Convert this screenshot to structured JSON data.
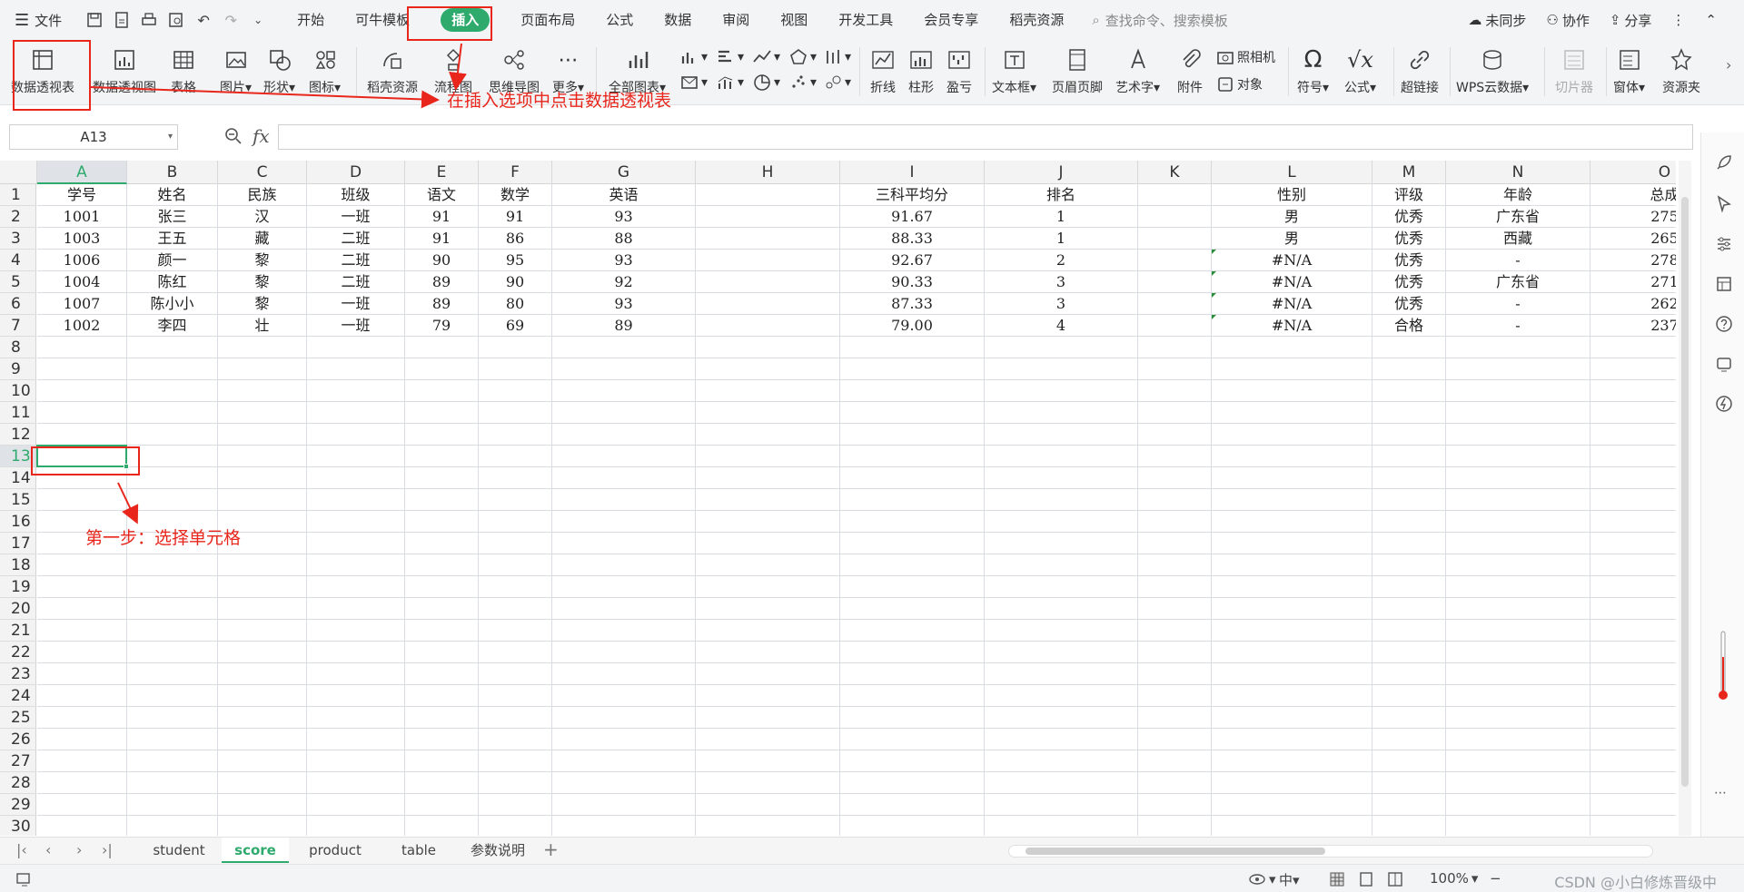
{
  "menubar": {
    "file_label": "文件",
    "tabs": [
      "开始",
      "可牛模板",
      "插入",
      "页面布局",
      "公式",
      "数据",
      "审阅",
      "视图",
      "开发工具",
      "会员专享",
      "稻壳资源"
    ],
    "active_tab": "插入",
    "search_placeholder": "查找命令、搜索模板",
    "right": {
      "sync": "未同步",
      "collab": "协作",
      "share": "分享"
    }
  },
  "ribbon": {
    "big_buttons": {
      "pivot_table": "数据透视表",
      "pivot_chart": "数据透视图",
      "table": "表格",
      "picture": "图片",
      "shape": "形状",
      "icon": "图标",
      "docer": "稻壳资源",
      "flowchart": "流程图",
      "mindmap": "思维导图",
      "more": "更多",
      "all_charts": "全部图表",
      "line": "折线",
      "column": "柱形",
      "winloss": "盈亏",
      "textbox": "文本框",
      "header_footer": "页眉页脚",
      "wordart": "艺术字",
      "attachment": "附件",
      "camera": "照相机",
      "object": "对象",
      "symbol": "符号",
      "formula": "公式",
      "hyperlink": "超链接",
      "wps_cloud": "WPS云数据",
      "slicer": "切片器",
      "window": "窗体",
      "resources": "资源夹"
    }
  },
  "formula_bar": {
    "name_box": "A13",
    "fx": "fx",
    "value": ""
  },
  "columns": [
    "A",
    "B",
    "C",
    "D",
    "E",
    "F",
    "G",
    "H",
    "I",
    "J",
    "K",
    "L",
    "M",
    "N",
    "O"
  ],
  "selected_column": "A",
  "selected_row": "13",
  "rows": [
    "1",
    "2",
    "3",
    "4",
    "5",
    "6",
    "7",
    "8",
    "9",
    "10",
    "11",
    "12",
    "13",
    "14",
    "15",
    "16",
    "17",
    "18",
    "19",
    "20",
    "21",
    "22",
    "23",
    "24",
    "25",
    "26",
    "27",
    "28",
    "29",
    "30"
  ],
  "table": {
    "header": {
      "A": "学号",
      "B": "姓名",
      "C": "民族",
      "D": "班级",
      "E": "语文",
      "F": "数学",
      "G": "英语",
      "I": "三科平均分",
      "J": "排名",
      "L": "性别",
      "M": "评级",
      "N": "年龄",
      "O": "总成"
    },
    "data": [
      {
        "A": "1001",
        "B": "张三",
        "C": "汉",
        "D": "一班",
        "E": "91",
        "F": "91",
        "G": "93",
        "I": "91.67",
        "J": "1",
        "L": "男",
        "M": "优秀",
        "N": "广东省",
        "O": "275"
      },
      {
        "A": "1003",
        "B": "王五",
        "C": "藏",
        "D": "二班",
        "E": "91",
        "F": "86",
        "G": "88",
        "I": "88.33",
        "J": "1",
        "L": "男",
        "M": "优秀",
        "N": "西藏",
        "O": "265"
      },
      {
        "A": "1006",
        "B": "颜一",
        "C": "黎",
        "D": "二班",
        "E": "90",
        "F": "95",
        "G": "93",
        "I": "92.67",
        "J": "2",
        "L": "#N/A",
        "M": "优秀",
        "N": "-",
        "O": "278"
      },
      {
        "A": "1004",
        "B": "陈红",
        "C": "黎",
        "D": "二班",
        "E": "89",
        "F": "90",
        "G": "92",
        "I": "90.33",
        "J": "3",
        "L": "#N/A",
        "M": "优秀",
        "N": "广东省",
        "O": "271"
      },
      {
        "A": "1007",
        "B": "陈小小",
        "C": "黎",
        "D": "一班",
        "E": "89",
        "F": "80",
        "G": "93",
        "I": "87.33",
        "J": "3",
        "L": "#N/A",
        "M": "优秀",
        "N": "-",
        "O": "262"
      },
      {
        "A": "1002",
        "B": "李四",
        "C": "壮",
        "D": "一班",
        "E": "79",
        "F": "69",
        "G": "89",
        "I": "79.00",
        "J": "4",
        "L": "#N/A",
        "M": "合格",
        "N": "-",
        "O": "237"
      }
    ]
  },
  "sheets": [
    "student",
    "score",
    "product",
    "table",
    "参数说明"
  ],
  "active_sheet": "score",
  "statusbar": {
    "zoom": "100%",
    "watermark": "CSDN @小白修炼晋级中"
  },
  "annotations": {
    "insert_hint": "在插入选项中点击数据透视表",
    "step_one": "第一步：选择单元格"
  },
  "colors": {
    "accent": "#2eaa6c",
    "annotation": "#e8261c"
  }
}
